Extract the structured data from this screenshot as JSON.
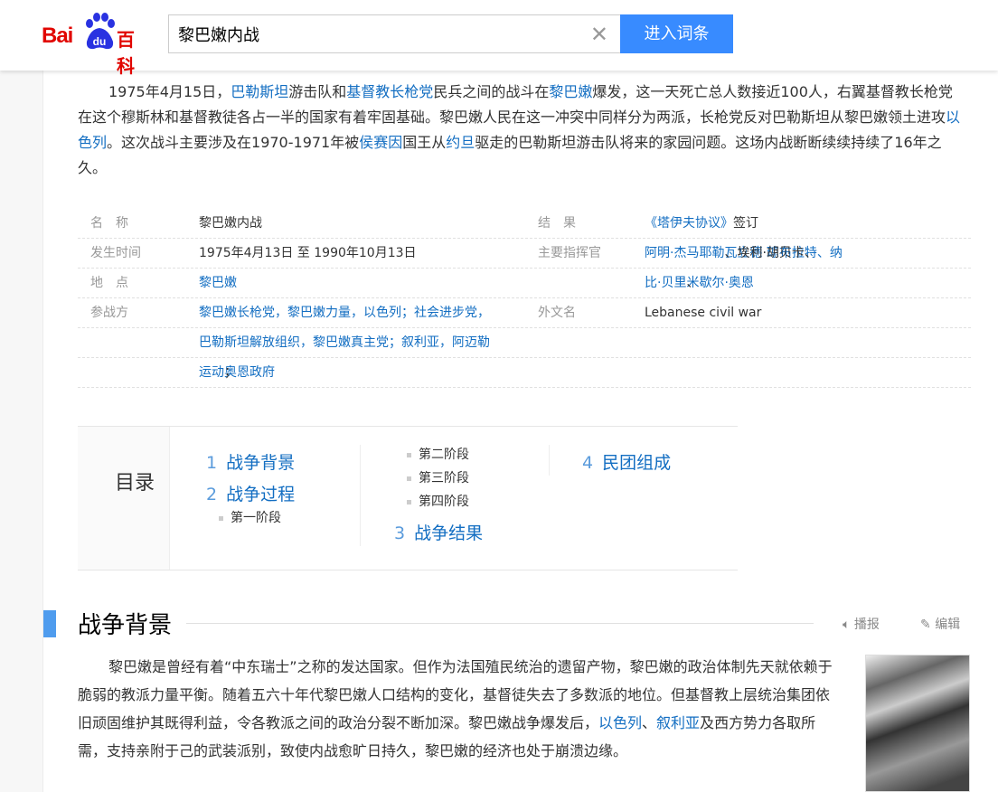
{
  "header": {
    "logo_text": "Baidu百科",
    "logo_bai": "Bai",
    "logo_du": "du",
    "logo_baike": "百科",
    "search_value": "黎巴嫩内战",
    "enter_button": "进入词条"
  },
  "intro": [
    {
      "t": "1975年4月15日，"
    },
    {
      "t": "巴勒斯坦",
      "link": true
    },
    {
      "t": "游击队和"
    },
    {
      "t": "基督教长枪党",
      "link": true
    },
    {
      "t": "民兵之间的战斗在"
    },
    {
      "t": "黎巴嫩",
      "link": true
    },
    {
      "t": "爆发，这一天死亡总人数接近100人，右翼基督教长枪党在这个穆斯林和基督教徒各占一半的国家有着牢固基础。黎巴嫩人民在这一冲突中同样分为两派，长枪党反对巴勒斯坦从黎巴嫩领土进攻"
    },
    {
      "t": "以色列",
      "link": true
    },
    {
      "t": "。这次战斗主要涉及在1970-1971年被"
    },
    {
      "t": "侯赛因",
      "link": true
    },
    {
      "t": "国王从"
    },
    {
      "t": "约旦",
      "link": true
    },
    {
      "t": "驱走的巴勒斯坦游击队将来的家园问题。这场内战断断续续持续了16年之久。"
    }
  ],
  "info": {
    "rows": [
      {
        "l1": "名　称",
        "v1": [
          {
            "t": "黎巴嫩内战"
          }
        ],
        "l2": "结　果",
        "v2": [
          {
            "t": "《塔伊夫协议》",
            "link": true
          },
          {
            "t": "签订"
          }
        ]
      },
      {
        "l1": "发生时间",
        "v1": [
          {
            "t": "1975年4月13日 至 1990年10月13日"
          }
        ],
        "l2": "主要指挥官",
        "v2": [
          {
            "t": "阿明·杰马耶勒",
            "link": true
          },
          {
            "t": "、埃利·胡贝卡、"
          },
          {
            "t": "瓦立德·琼布拉特",
            "link": true
          },
          {
            "t": "、纳",
            "link": true
          }
        ]
      },
      {
        "l1": "地　点",
        "v1": [
          {
            "t": "黎巴嫩",
            "link": true
          }
        ],
        "l2": "",
        "v2": [
          {
            "t": "比·贝里",
            "link": true
          },
          {
            "t": "、"
          },
          {
            "t": "米歇尔·奥恩",
            "link": true
          }
        ]
      },
      {
        "l1": "参战方",
        "v1": [
          {
            "t": "黎巴嫩长枪党，黎巴嫩力量，以色列；社会进步党，",
            "link": true
          }
        ],
        "l2": "外文名",
        "v2": [
          {
            "t": "Lebanese civil war"
          }
        ]
      },
      {
        "l1": "",
        "v1": [
          {
            "t": "巴勒斯坦解放组织，黎巴嫩真主党；叙利亚，阿迈勒",
            "link": true
          }
        ],
        "l2": "",
        "v2": []
      },
      {
        "l1": "",
        "v1": [
          {
            "t": "运动",
            "link": true
          },
          {
            "t": "；"
          },
          {
            "t": "奥恩政府",
            "link": true
          }
        ],
        "l2": "",
        "v2": []
      }
    ]
  },
  "toc": {
    "title": "目录",
    "items": [
      {
        "num": "1",
        "label": "战争背景"
      },
      {
        "num": "2",
        "label": "战争过程"
      },
      {
        "num": "3",
        "label": "战争结果"
      },
      {
        "num": "4",
        "label": "民团组成"
      }
    ],
    "sub": [
      "第一阶段",
      "第二阶段",
      "第三阶段",
      "第四阶段"
    ]
  },
  "section": {
    "title": "战争背景",
    "broadcast": "播报",
    "edit": "编辑",
    "para": [
      {
        "t": "黎巴嫩是曾经有着“中东瑞士”之称的发达国家。但作为法国殖民统治的遗留产物，黎巴嫩的政治体制先天就依赖于脆弱的教派力量平衡。随着五六十年代黎巴嫩人口结构的变化，基督徒失去了多数派的地位。但基督教上层统治集团依旧顽固维护其既得利益，令各教派之间的政治分裂不断加深。黎巴嫩战争爆发后，"
      },
      {
        "t": "以色列",
        "link": true
      },
      {
        "t": "、"
      },
      {
        "t": "叙利亚",
        "link": true
      },
      {
        "t": "及西方势力各取所需，支持亲附于己的武装派别，致使内战愈旷日持久，黎巴嫩的经济也处于崩溃边缘。"
      }
    ]
  },
  "colors": {
    "link": "#136ec2",
    "accent": "#388bff",
    "logo_red": "#e10601",
    "logo_blue": "#2932e1"
  }
}
